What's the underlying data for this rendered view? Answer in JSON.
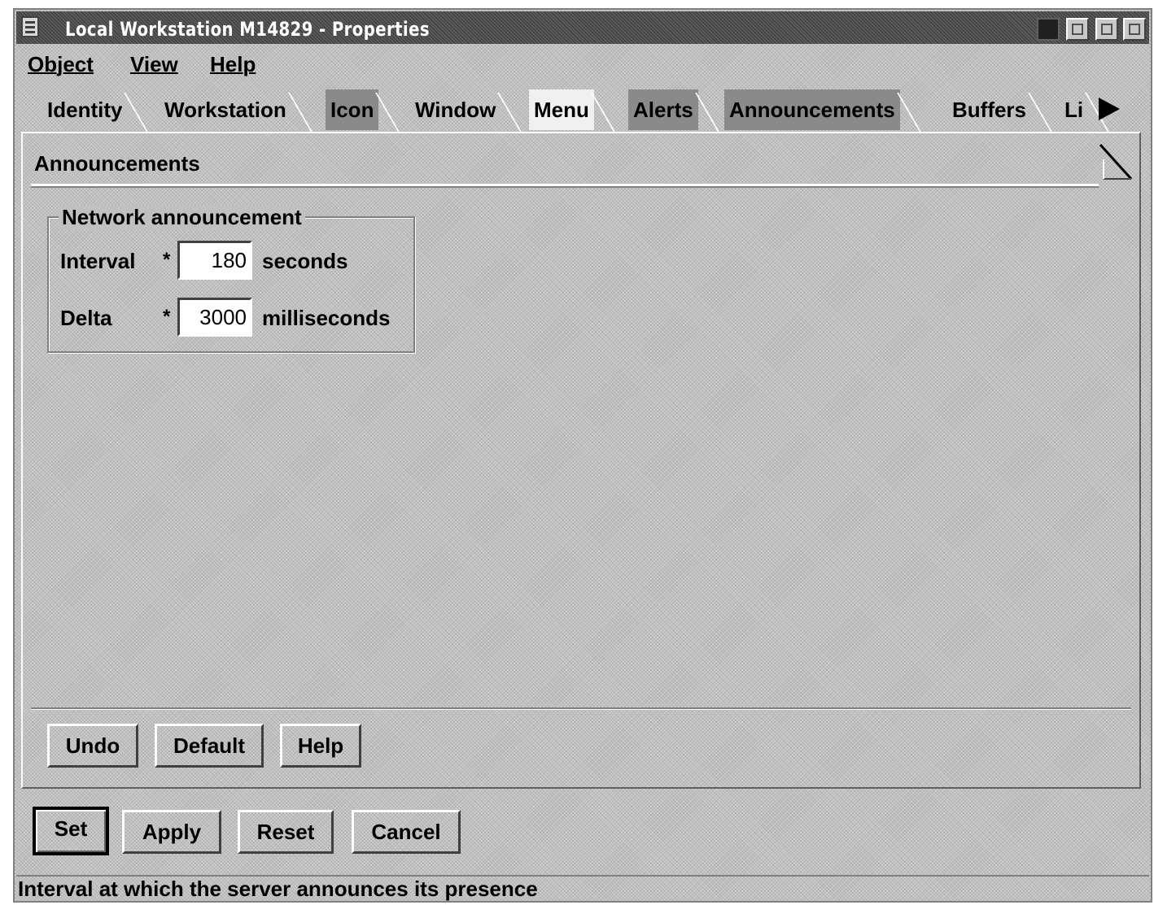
{
  "window": {
    "title": "Local Workstation M14829 - Properties"
  },
  "menubar": {
    "items": [
      {
        "label": "Object"
      },
      {
        "label": "View"
      },
      {
        "label": "Help"
      }
    ]
  },
  "tabs": [
    {
      "label": "Identity",
      "state": "normal"
    },
    {
      "label": "Workstation",
      "state": "normal"
    },
    {
      "label": "Icon",
      "state": "dark"
    },
    {
      "label": "Window",
      "state": "normal"
    },
    {
      "label": "Menu",
      "state": "active"
    },
    {
      "label": "Alerts",
      "state": "dark"
    },
    {
      "label": "Announcements",
      "state": "selected"
    },
    {
      "label": "Buffers",
      "state": "normal"
    },
    {
      "label": "Li",
      "state": "normal"
    }
  ],
  "page": {
    "title": "Announcements",
    "group": {
      "legend": "Network announcement",
      "fields": [
        {
          "label": "Interval",
          "required": "*",
          "value": "180",
          "unit": "seconds"
        },
        {
          "label": "Delta",
          "required": "*",
          "value": "3000",
          "unit": "milliseconds"
        }
      ]
    },
    "buttons": {
      "undo": "Undo",
      "default": "Default",
      "help": "Help"
    }
  },
  "dialog_buttons": {
    "set": "Set",
    "apply": "Apply",
    "reset": "Reset",
    "cancel": "Cancel"
  },
  "status": {
    "text": "Interval at which the server announces its presence"
  },
  "colors": {
    "face": "#c0c0c0",
    "titlebar": "#5a5a5a",
    "entry_bg": "#ffffff"
  }
}
